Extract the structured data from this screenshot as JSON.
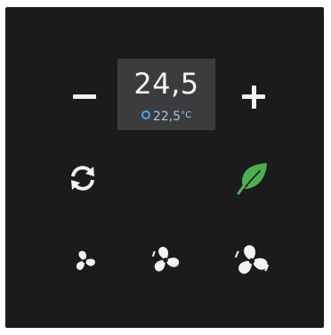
{
  "thermostat": {
    "setpoint": "24,5",
    "current_temp": "22,5",
    "current_unit": "°C"
  },
  "colors": {
    "panel_bg": "#1b1b1d",
    "display_bg": "#3c3c3e",
    "icon": "#f2f2f2",
    "accent_blue": "#4da3e6",
    "leaf_green": "#4caf50"
  },
  "icons": {
    "decrease": "minus-icon",
    "increase": "plus-icon",
    "mode": "sync-icon",
    "eco": "leaf-icon",
    "fan_low": "fan-low-icon",
    "fan_medium": "fan-medium-icon",
    "fan_high": "fan-high-icon"
  }
}
